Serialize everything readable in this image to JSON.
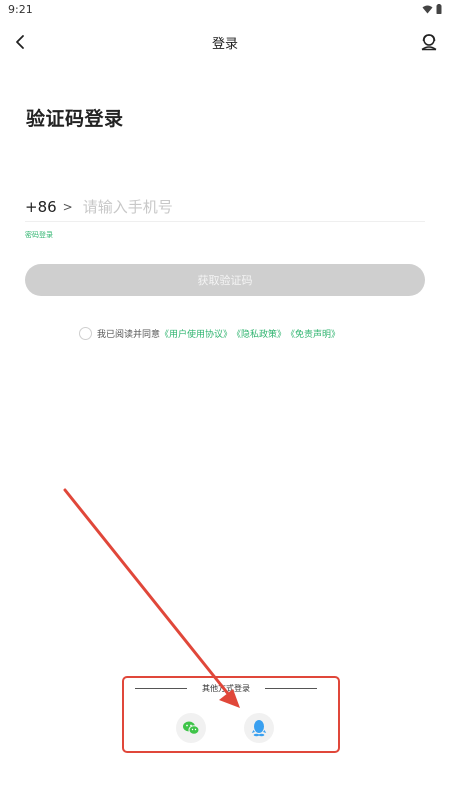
{
  "status_bar": {
    "time": "9:21"
  },
  "top_bar": {
    "title": "登录",
    "back_icon": "chevron-left-icon",
    "service_icon": "customer-service-icon"
  },
  "heading": "验证码登录",
  "phone": {
    "country_code": "+86",
    "chevron": ">",
    "placeholder": "请输入手机号",
    "value": ""
  },
  "password_login_label": "密码登录",
  "get_code_button": "获取验证码",
  "agreement": {
    "prefix": "我已阅读并同意",
    "links": [
      "《用户使用协议》",
      "《隐私政策》",
      "《免责声明》"
    ]
  },
  "other_login": {
    "title": "其他方式登录",
    "methods": [
      {
        "name": "wechat",
        "icon": "wechat-icon"
      },
      {
        "name": "qq",
        "icon": "qq-icon"
      }
    ]
  },
  "colors": {
    "accent": "#2fb46f",
    "button_disabled": "#cfcfcf",
    "annotation": "#e0473a",
    "qq_blue": "#3aa0f0",
    "wechat_green": "#3fc449"
  }
}
